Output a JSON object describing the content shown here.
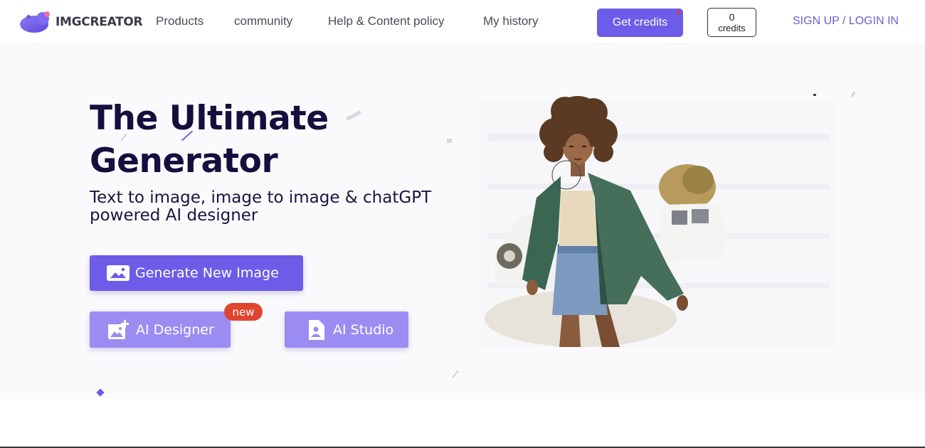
{
  "header": {
    "logo_text": "IMGCREATOR",
    "nav": [
      "Products",
      "community",
      "Help & Content policy",
      "My history"
    ],
    "get_credits_label": "Get credits",
    "credits_count": "0",
    "credits_label": "credits",
    "auth_label": "SIGN UP / LOGIN IN"
  },
  "hero": {
    "title_line1": "The Ultimate",
    "title_line2": "Generator",
    "subtitle_line1": "Text to image, image to image & chatGPT",
    "subtitle_line2": "powered AI designer",
    "buttons": {
      "generate": "Generate New Image",
      "designer": "AI Designer",
      "studio": "AI Studio"
    },
    "badge_new": "new",
    "icons": {
      "generate": "image-icon",
      "designer": "image-add-icon",
      "studio": "portrait-icon"
    }
  },
  "colors": {
    "accent": "#6c5ce7",
    "accent_light": "#9b8cf2",
    "badge": "#e0452f",
    "title": "#140f3d"
  }
}
